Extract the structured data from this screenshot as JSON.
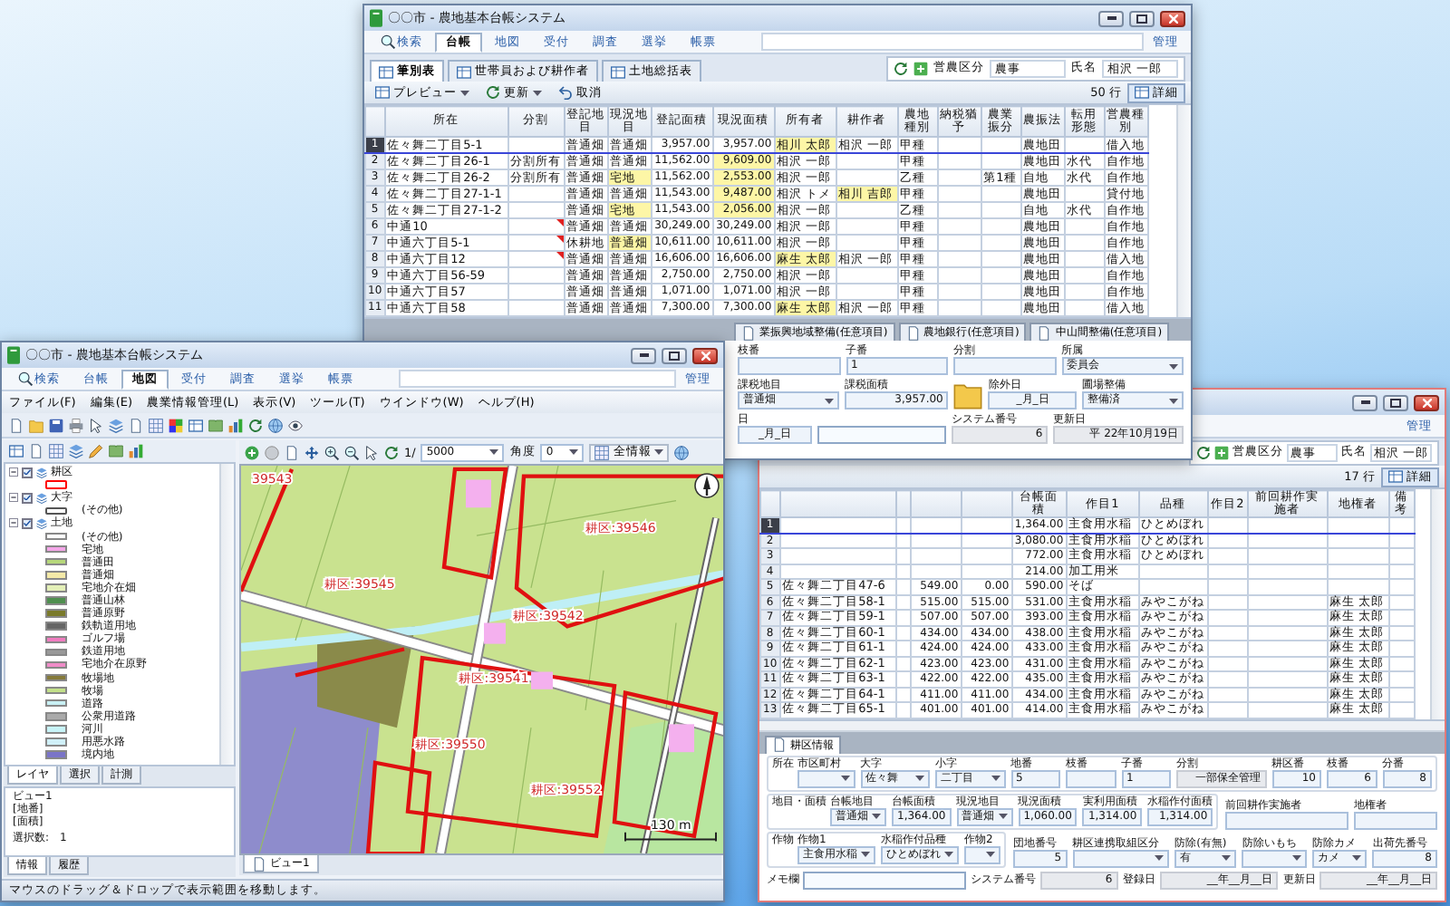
{
  "ledger_window": {
    "title": "〇〇市 - 農地基本台帳システム",
    "nav_tabs": [
      {
        "label": "検索",
        "selected": false
      },
      {
        "label": "台帳",
        "selected": true
      },
      {
        "label": "地図",
        "selected": false
      },
      {
        "label": "受付",
        "selected": false
      },
      {
        "label": "調査",
        "selected": false
      },
      {
        "label": "選挙",
        "selected": false
      },
      {
        "label": "帳票",
        "selected": false
      }
    ],
    "admin_link": "管理",
    "sub_tabs": [
      {
        "label": "筆別表",
        "selected": true
      },
      {
        "label": "世帯員および耕作者",
        "selected": false
      },
      {
        "label": "土地総括表",
        "selected": false
      }
    ],
    "filters": [
      {
        "label": "営農区分",
        "value": "農事"
      },
      {
        "label": "氏名",
        "value": "相沢 一郎"
      }
    ],
    "toolbar": [
      {
        "label": "プレビュー",
        "menu": true
      },
      {
        "label": "更新",
        "menu": true
      },
      {
        "label": "取消",
        "menu": false
      }
    ],
    "row_count": "50 行",
    "detail_button": "詳細",
    "table": {
      "columns": [
        {
          "label": "所在",
          "kind": "text"
        },
        {
          "label": "分割",
          "kind": "text"
        },
        {
          "label": "登記地目",
          "kind": "text"
        },
        {
          "label": "現況地目",
          "kind": "text"
        },
        {
          "label": "登記面積",
          "kind": "number"
        },
        {
          "label": "現況面積",
          "kind": "number"
        },
        {
          "label": "所有者",
          "kind": "text"
        },
        {
          "label": "耕作者",
          "kind": "text"
        },
        {
          "label": "農地種別",
          "kind": "text"
        },
        {
          "label": "納税猶予",
          "kind": "text"
        },
        {
          "label": "農業振分",
          "kind": "text"
        },
        {
          "label": "農振法",
          "kind": "text"
        },
        {
          "label": "転用形態",
          "kind": "text"
        },
        {
          "label": "営農種別",
          "kind": "text"
        }
      ],
      "rows": [
        {
          "no": "1",
          "selected": true,
          "flagged": false,
          "cells": [
            "佐々舞二丁目5-1",
            null,
            "普通畑",
            "普通畑",
            "3,957.00",
            "3,957.00",
            {
              "text": "相川 太郎",
              "highlighted": true
            },
            "相沢 一郎",
            "甲種",
            null,
            null,
            "農地田",
            null,
            "借入地"
          ]
        },
        {
          "no": "2",
          "selected": false,
          "flagged": false,
          "cells": [
            "佐々舞二丁目26-1",
            "分割所有",
            "普通畑",
            "普通畑",
            "11,562.00",
            {
              "text": "9,609.00",
              "highlighted": true
            },
            "相沢 一郎",
            null,
            "甲種",
            null,
            null,
            "農地田",
            "水代",
            "自作地"
          ]
        },
        {
          "no": "3",
          "selected": false,
          "flagged": false,
          "cells": [
            "佐々舞二丁目26-2",
            "分割所有",
            "普通畑",
            {
              "text": "宅地",
              "highlighted": true
            },
            "11,562.00",
            {
              "text": "2,553.00",
              "highlighted": true
            },
            "相沢 一郎",
            null,
            "乙種",
            null,
            "第1種",
            "自地",
            "水代",
            "自作地"
          ]
        },
        {
          "no": "4",
          "selected": false,
          "flagged": false,
          "cells": [
            "佐々舞二丁目27-1-1",
            null,
            "普通畑",
            "普通畑",
            "11,543.00",
            {
              "text": "9,487.00",
              "highlighted": true
            },
            "相沢 トメ",
            {
              "text": "相川 吉郎",
              "highlighted": true
            },
            "甲種",
            null,
            null,
            "農地田",
            null,
            "貸付地"
          ]
        },
        {
          "no": "5",
          "selected": false,
          "flagged": false,
          "cells": [
            "佐々舞二丁目27-1-2",
            null,
            "普通畑",
            {
              "text": "宅地",
              "highlighted": true
            },
            "11,543.00",
            {
              "text": "2,056.00",
              "highlighted": true
            },
            "相沢 一郎",
            null,
            "乙種",
            null,
            null,
            "自地",
            "水代",
            "自作地"
          ]
        },
        {
          "no": "6",
          "selected": false,
          "flagged": true,
          "cells": [
            "中通10",
            null,
            "普通畑",
            "普通畑",
            "30,249.00",
            "30,249.00",
            "相沢 一郎",
            null,
            "甲種",
            null,
            null,
            "農地田",
            null,
            "自作地"
          ]
        },
        {
          "no": "7",
          "selected": false,
          "flagged": true,
          "cells": [
            "中通六丁目5-1",
            null,
            "休耕地",
            {
              "text": "普通畑",
              "highlighted": true
            },
            "10,611.00",
            "10,611.00",
            "相沢 一郎",
            null,
            "甲種",
            null,
            null,
            "農地田",
            null,
            "自作地"
          ]
        },
        {
          "no": "8",
          "selected": false,
          "flagged": true,
          "cells": [
            "中通六丁目12",
            null,
            "普通畑",
            "普通畑",
            "16,606.00",
            "16,606.00",
            {
              "text": "麻生 太郎",
              "highlighted": true
            },
            "相沢 一郎",
            "甲種",
            null,
            null,
            "農地田",
            null,
            "借入地"
          ]
        },
        {
          "no": "9",
          "selected": false,
          "flagged": false,
          "cells": [
            "中通六丁目56-59",
            null,
            "普通畑",
            "普通畑",
            "2,750.00",
            "2,750.00",
            "相沢 一郎",
            null,
            "甲種",
            null,
            null,
            "農地田",
            null,
            "自作地"
          ]
        },
        {
          "no": "10",
          "selected": false,
          "flagged": false,
          "cells": [
            "中通六丁目57",
            null,
            "普通畑",
            "普通畑",
            "1,071.00",
            "1,071.00",
            "相沢 一郎",
            null,
            "甲種",
            null,
            null,
            "農地田",
            null,
            "自作地"
          ]
        },
        {
          "no": "11",
          "selected": false,
          "flagged": false,
          "cells": [
            "中通六丁目58",
            null,
            "普通畑",
            "普通畑",
            "7,300.00",
            "7,300.00",
            {
              "text": "麻生 太郎",
              "highlighted": true
            },
            "相沢 一郎",
            "甲種",
            null,
            null,
            "農地田",
            null,
            "借入地"
          ]
        }
      ]
    },
    "form": {
      "tabs": [
        {
          "label": "業振興地域整備(任意項目)",
          "selected": false
        },
        {
          "label": "農地銀行(任意項目)",
          "selected": false
        },
        {
          "label": "中山間整備(任意項目)",
          "selected": false
        }
      ],
      "rows": [
        [
          {
            "label": "枝番",
            "kind": "text"
          },
          {
            "label": "子番",
            "kind": "text",
            "value": "1"
          },
          {
            "label": "分割",
            "kind": "text"
          },
          {
            "label": "所属",
            "kind": "dropdown",
            "value": "委員会"
          }
        ],
        [
          {
            "label": "課税地目",
            "kind": "dropdown",
            "value": "普通畑"
          },
          {
            "label": "課税面積",
            "kind": "number",
            "value": "3,957.00"
          },
          {
            "label": "除外日",
            "kind": "date",
            "value": "_月_日"
          },
          {
            "label": "圃場整備",
            "kind": "dropdown",
            "value": "整備済"
          }
        ],
        [
          {
            "label": "日",
            "kind": "date",
            "value": "_月_日"
          },
          {
            "kind": "memo"
          },
          {
            "label": "システム番号",
            "kind": "readonly",
            "value": "6"
          },
          {
            "label": "更新日",
            "kind": "readonly",
            "value": "平 22年10月19日"
          }
        ]
      ]
    }
  },
  "map_window": {
    "title": "〇〇市 - 農地基本台帳システム",
    "nav_tabs": [
      {
        "label": "検索",
        "selected": false
      },
      {
        "label": "台帳",
        "selected": false
      },
      {
        "label": "地図",
        "selected": true
      },
      {
        "label": "受付",
        "selected": false
      },
      {
        "label": "調査",
        "selected": false
      },
      {
        "label": "選挙",
        "selected": false
      },
      {
        "label": "帳票",
        "selected": false
      }
    ],
    "admin_link": "管理",
    "menu": [
      "ファイル(F)",
      "編集(E)",
      "農業情報管理(L)",
      "表示(V)",
      "ツール(T)",
      "ウインドウ(W)",
      "ヘルプ(H)"
    ],
    "map_toolbar": {
      "scale_prefix": "1/",
      "scale": "5000",
      "angle_label": "角度",
      "angle": "0",
      "view_dropdown": "全情報"
    },
    "legend": [
      {
        "label": "耕区",
        "checked": true,
        "expanded": true,
        "children": [
          {
            "kind": "outline",
            "color": "#ff0000"
          }
        ]
      },
      {
        "label": "大字",
        "checked": true,
        "expanded": true,
        "children": [
          {
            "kind": "outline",
            "color": "#555555",
            "label": "(その他)"
          }
        ]
      },
      {
        "label": "土地",
        "checked": true,
        "expanded": true,
        "children": [
          {
            "kind": "fill",
            "color": "#ffffff",
            "label": "(その他)"
          },
          {
            "kind": "fill",
            "color": "#f4a6e8",
            "label": "宅地"
          },
          {
            "kind": "fill",
            "color": "#b6d77a",
            "label": "普通田"
          },
          {
            "kind": "fill",
            "color": "#f5eaa8",
            "label": "普通畑"
          },
          {
            "kind": "fill",
            "color": "#e4f0b8",
            "label": "宅地介在畑"
          },
          {
            "kind": "fill",
            "color": "#4f8f4f",
            "label": "普通山林"
          },
          {
            "kind": "fill",
            "color": "#7a7a2a",
            "label": "普通原野"
          },
          {
            "kind": "fill",
            "color": "#666666",
            "label": "鉄軌道用地"
          },
          {
            "kind": "fill",
            "color": "#f07cc0",
            "label": "ゴルフ場"
          },
          {
            "kind": "fill",
            "color": "#999999",
            "label": "鉄道用地"
          },
          {
            "kind": "fill",
            "color": "#f08cc8",
            "label": "宅地介在原野"
          },
          {
            "kind": "fill",
            "color": "#857a3a",
            "label": "牧場地"
          },
          {
            "kind": "fill",
            "color": "#c3e08a",
            "label": "牧場"
          },
          {
            "kind": "fill",
            "color": "#c8f0f4",
            "label": "道路"
          },
          {
            "kind": "fill",
            "color": "#aaaaaa",
            "label": "公衆用道路"
          },
          {
            "kind": "fill",
            "color": "#c8f4f8",
            "label": "河川"
          },
          {
            "kind": "fill",
            "color": "#d0f0f8",
            "label": "用悪水路"
          },
          {
            "kind": "fill",
            "color": "#7a74c8",
            "label": "境内地"
          }
        ]
      }
    ],
    "panel_tabs": [
      {
        "label": "レイヤ",
        "selected": true
      },
      {
        "label": "選択",
        "selected": false
      },
      {
        "label": "計測",
        "selected": false
      }
    ],
    "info": {
      "title": "ビュー1",
      "lines": [
        "[地番]",
        "[面積]"
      ],
      "selection_label": "選択数:",
      "selection_count": "1"
    },
    "bottom_tabs": [
      {
        "label": "情報",
        "selected": true
      },
      {
        "label": "履歴",
        "selected": false
      }
    ],
    "map_tabs": [
      {
        "label": "ビュー1",
        "selected": true
      }
    ],
    "map_labels": [
      "39543",
      "耕区:39546",
      "耕区:39545",
      "耕区:39542",
      "耕区:39541",
      "耕区:39550",
      "耕区:39552"
    ],
    "scale_label": "130 m",
    "status": "マウスのドラッグ＆ドロップで表示範囲を移動します。"
  },
  "crop_window": {
    "admin_link": "管理",
    "filters": [
      {
        "label": "営農区分",
        "value": "農事"
      },
      {
        "label": "氏名",
        "value": "相沢 一郎"
      }
    ],
    "row_count": "17 行",
    "detail_button": "詳細",
    "table": {
      "columns": [
        {
          "kind": "text"
        },
        {
          "kind": "text"
        },
        {
          "kind": "number"
        },
        {
          "kind": "number"
        },
        {
          "label": "台帳面積",
          "kind": "number"
        },
        {
          "label": "作目1",
          "kind": "text"
        },
        {
          "label": "品種",
          "kind": "text"
        },
        {
          "label": "作目2",
          "kind": "text"
        },
        {
          "label": "前回耕作実施者",
          "kind": "text"
        },
        {
          "label": "地権者",
          "kind": "text"
        },
        {
          "label": "備考",
          "kind": "text"
        }
      ],
      "rows": [
        {
          "no": "1",
          "selected": true,
          "cells": [
            null,
            null,
            null,
            null,
            "1,364.00",
            "主食用水稲",
            "ひとめぼれ",
            null,
            null,
            null,
            null
          ]
        },
        {
          "no": "2",
          "selected": false,
          "cells": [
            null,
            null,
            null,
            null,
            "3,080.00",
            "主食用水稲",
            "ひとめぼれ",
            null,
            null,
            null,
            null
          ]
        },
        {
          "no": "3",
          "selected": false,
          "cells": [
            null,
            null,
            null,
            null,
            "772.00",
            "主食用水稲",
            "ひとめぼれ",
            null,
            null,
            null,
            null
          ]
        },
        {
          "no": "4",
          "selected": false,
          "cells": [
            null,
            null,
            null,
            null,
            "214.00",
            "加工用米",
            null,
            null,
            null,
            null,
            null
          ]
        },
        {
          "no": "5",
          "selected": false,
          "cells": [
            "佐々舞二丁目47-6",
            null,
            "549.00",
            "0.00",
            "590.00",
            "そば",
            null,
            null,
            null,
            null,
            null
          ]
        },
        {
          "no": "6",
          "selected": false,
          "cells": [
            "佐々舞二丁目58-1",
            null,
            "515.00",
            "515.00",
            "531.00",
            "主食用水稲",
            "みやこがね",
            null,
            null,
            "麻生 太郎",
            null
          ]
        },
        {
          "no": "7",
          "selected": false,
          "cells": [
            "佐々舞二丁目59-1",
            null,
            "507.00",
            "507.00",
            "393.00",
            "主食用水稲",
            "みやこがね",
            null,
            null,
            "麻生 太郎",
            null
          ]
        },
        {
          "no": "8",
          "selected": false,
          "cells": [
            "佐々舞二丁目60-1",
            null,
            "434.00",
            "434.00",
            "438.00",
            "主食用水稲",
            "みやこがね",
            null,
            null,
            "麻生 太郎",
            null
          ]
        },
        {
          "no": "9",
          "selected": false,
          "cells": [
            "佐々舞二丁目61-1",
            null,
            "424.00",
            "424.00",
            "433.00",
            "主食用水稲",
            "みやこがね",
            null,
            null,
            "麻生 太郎",
            null
          ]
        },
        {
          "no": "10",
          "selected": false,
          "cells": [
            "佐々舞二丁目62-1",
            null,
            "423.00",
            "423.00",
            "431.00",
            "主食用水稲",
            "みやこがね",
            null,
            null,
            "麻生 太郎",
            null
          ]
        },
        {
          "no": "11",
          "selected": false,
          "cells": [
            "佐々舞二丁目63-1",
            null,
            "422.00",
            "422.00",
            "435.00",
            "主食用水稲",
            "みやこがね",
            null,
            null,
            "麻生 太郎",
            null
          ]
        },
        {
          "no": "12",
          "selected": false,
          "cells": [
            "佐々舞二丁目64-1",
            null,
            "411.00",
            "411.00",
            "434.00",
            "主食用水稲",
            "みやこがね",
            null,
            null,
            "麻生 太郎",
            null
          ]
        },
        {
          "no": "13",
          "selected": false,
          "cells": [
            "佐々舞二丁目65-1",
            null,
            "401.00",
            "401.00",
            "414.00",
            "主食用水稲",
            "みやこがね",
            null,
            null,
            "麻生 太郎",
            null
          ]
        }
      ]
    },
    "form": {
      "tabs": [
        {
          "label": "耕区情報",
          "selected": true
        }
      ],
      "sections": [
        {
          "title": "所在",
          "fields": [
            {
              "label": "市区町村",
              "kind": "dropdown"
            },
            {
              "label": "大字",
              "kind": "dropdown",
              "value": "佐々舞"
            },
            {
              "label": "小字",
              "kind": "dropdown",
              "value": "二丁目"
            },
            {
              "label": "地番",
              "kind": "text",
              "value": "5"
            },
            {
              "label": "枝番",
              "kind": "text"
            },
            {
              "label": "子番",
              "kind": "text",
              "value": "1"
            },
            {
              "label": "分割",
              "kind": "readonly",
              "value": "一部保全管理"
            },
            {
              "label": "耕区番",
              "kind": "number",
              "value": "10"
            },
            {
              "label": "枝番",
              "kind": "number",
              "value": "6"
            },
            {
              "label": "分番",
              "kind": "number",
              "value": "8"
            }
          ]
        },
        {
          "title": "地目・面積",
          "fields": [
            {
              "label": "台帳地目",
              "kind": "dropdown",
              "value": "普通畑"
            },
            {
              "label": "台帳面積",
              "kind": "number",
              "value": "1,364.00"
            },
            {
              "label": "現況地目",
              "kind": "dropdown",
              "value": "普通畑"
            },
            {
              "label": "現況面積",
              "kind": "number",
              "value": "1,060.00"
            },
            {
              "label": "実利用面積",
              "kind": "number",
              "value": "1,314.00"
            },
            {
              "label": "水稲作付面積",
              "kind": "number",
              "value": "1,314.00"
            }
          ],
          "side_fields": [
            {
              "label": "前回耕作実施者",
              "kind": "text"
            },
            {
              "label": "地権者",
              "kind": "text"
            }
          ]
        },
        {
          "title": "作物",
          "fields": [
            {
              "label": "作物1",
              "kind": "dropdown",
              "value": "主食用水稲"
            },
            {
              "label": "水稲作付品種",
              "kind": "dropdown",
              "value": "ひとめぼれ"
            },
            {
              "label": "作物2",
              "kind": "dropdown"
            }
          ],
          "side_fields": [
            {
              "label": "団地番号",
              "kind": "number",
              "value": "5"
            },
            {
              "label": "耕区連携取組区分",
              "kind": "dropdown"
            },
            {
              "label": "防除(有無)",
              "kind": "dropdown",
              "value": "有"
            },
            {
              "label": "防除いもち",
              "kind": "dropdown"
            },
            {
              "label": "防除カメ",
              "kind": "dropdown",
              "value": "カメ"
            },
            {
              "label": "出荷先番号",
              "kind": "number",
              "value": "8"
            }
          ]
        }
      ],
      "bottom_fields": [
        {
          "label": "メモ欄",
          "kind": "memo"
        },
        {
          "label": "システム番号",
          "kind": "readonly",
          "value": "6"
        },
        {
          "label": "登録日",
          "kind": "readonly",
          "value": "__年__月__日"
        },
        {
          "label": "更新日",
          "kind": "readonly",
          "value": "__年__月__日"
        }
      ]
    }
  }
}
